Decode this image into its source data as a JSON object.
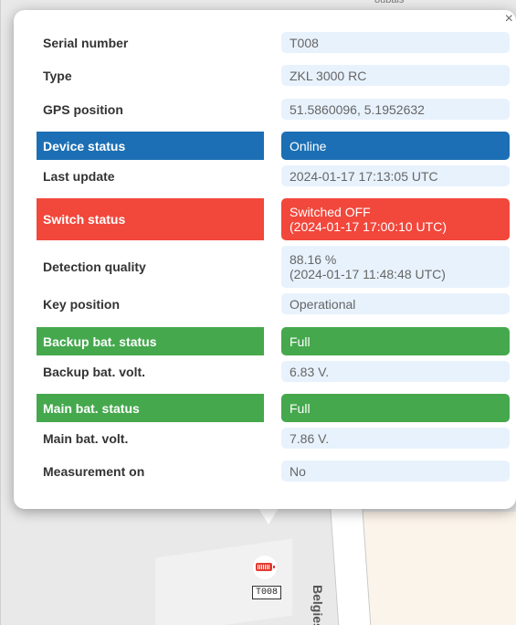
{
  "map": {
    "street_label": "Belgiestr",
    "top_street_label": "oubais"
  },
  "marker": {
    "label": "T008",
    "icon": "battery-icon",
    "color": "#e23b30"
  },
  "popup": {
    "close_label": "×",
    "rows": [
      {
        "label": "Serial number",
        "value": "T008",
        "highlight": "none"
      },
      {
        "label": "Type",
        "value": "ZKL 3000 RC",
        "highlight": "none"
      },
      {
        "label": "GPS position",
        "value": "51.5860096, 5.1952632",
        "highlight": "none"
      },
      {
        "label": "Device status",
        "value": "Online",
        "highlight": "blue"
      },
      {
        "label": "Last update",
        "value": "2024-01-17 17:13:05 UTC",
        "highlight": "none"
      },
      {
        "label": "Switch status",
        "value": "Switched OFF",
        "value_line2": "(2024-01-17 17:00:10 UTC)",
        "highlight": "red"
      },
      {
        "label": "Detection quality",
        "value": "88.16 %",
        "value_line2": "(2024-01-17 11:48:48 UTC)",
        "highlight": "none"
      },
      {
        "label": "Key position",
        "value": "Operational",
        "highlight": "none"
      },
      {
        "label": "Backup bat. status",
        "value": "Full",
        "highlight": "green"
      },
      {
        "label": "Backup bat. volt.",
        "value": "6.83 V.",
        "highlight": "none"
      },
      {
        "label": "Main bat. status",
        "value": "Full",
        "highlight": "green"
      },
      {
        "label": "Main bat. volt.",
        "value": "7.86 V.",
        "highlight": "none"
      },
      {
        "label": "Measurement on",
        "value": "No",
        "highlight": "none"
      }
    ]
  },
  "colors": {
    "blue": "#1c6fb4",
    "red": "#f2473b",
    "green": "#45a84d",
    "value_bg": "#e8f2fd"
  }
}
